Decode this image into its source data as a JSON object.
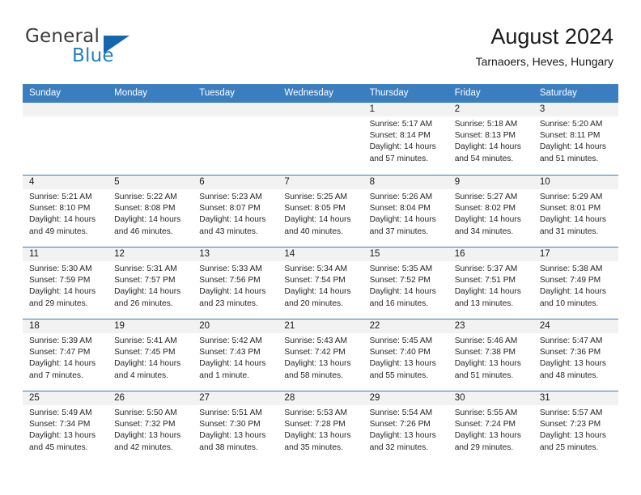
{
  "brand": {
    "name_part1": "General",
    "name_part2": "Blue",
    "accent_color": "#1666ad",
    "blue_text_color": "#1f7fc4"
  },
  "header": {
    "month_title": "August 2024",
    "location": "Tarnaoers, Heves, Hungary"
  },
  "calendar": {
    "header_background": "#3b7ec0",
    "weekday_headers": [
      "Sunday",
      "Monday",
      "Tuesday",
      "Wednesday",
      "Thursday",
      "Friday",
      "Saturday"
    ],
    "weeks": [
      [
        {
          "day": "",
          "sunrise": "",
          "sunset": "",
          "daylight1": "",
          "daylight2": ""
        },
        {
          "day": "",
          "sunrise": "",
          "sunset": "",
          "daylight1": "",
          "daylight2": ""
        },
        {
          "day": "",
          "sunrise": "",
          "sunset": "",
          "daylight1": "",
          "daylight2": ""
        },
        {
          "day": "",
          "sunrise": "",
          "sunset": "",
          "daylight1": "",
          "daylight2": ""
        },
        {
          "day": "1",
          "sunrise": "Sunrise: 5:17 AM",
          "sunset": "Sunset: 8:14 PM",
          "daylight1": "Daylight: 14 hours",
          "daylight2": "and 57 minutes."
        },
        {
          "day": "2",
          "sunrise": "Sunrise: 5:18 AM",
          "sunset": "Sunset: 8:13 PM",
          "daylight1": "Daylight: 14 hours",
          "daylight2": "and 54 minutes."
        },
        {
          "day": "3",
          "sunrise": "Sunrise: 5:20 AM",
          "sunset": "Sunset: 8:11 PM",
          "daylight1": "Daylight: 14 hours",
          "daylight2": "and 51 minutes."
        }
      ],
      [
        {
          "day": "4",
          "sunrise": "Sunrise: 5:21 AM",
          "sunset": "Sunset: 8:10 PM",
          "daylight1": "Daylight: 14 hours",
          "daylight2": "and 49 minutes."
        },
        {
          "day": "5",
          "sunrise": "Sunrise: 5:22 AM",
          "sunset": "Sunset: 8:08 PM",
          "daylight1": "Daylight: 14 hours",
          "daylight2": "and 46 minutes."
        },
        {
          "day": "6",
          "sunrise": "Sunrise: 5:23 AM",
          "sunset": "Sunset: 8:07 PM",
          "daylight1": "Daylight: 14 hours",
          "daylight2": "and 43 minutes."
        },
        {
          "day": "7",
          "sunrise": "Sunrise: 5:25 AM",
          "sunset": "Sunset: 8:05 PM",
          "daylight1": "Daylight: 14 hours",
          "daylight2": "and 40 minutes."
        },
        {
          "day": "8",
          "sunrise": "Sunrise: 5:26 AM",
          "sunset": "Sunset: 8:04 PM",
          "daylight1": "Daylight: 14 hours",
          "daylight2": "and 37 minutes."
        },
        {
          "day": "9",
          "sunrise": "Sunrise: 5:27 AM",
          "sunset": "Sunset: 8:02 PM",
          "daylight1": "Daylight: 14 hours",
          "daylight2": "and 34 minutes."
        },
        {
          "day": "10",
          "sunrise": "Sunrise: 5:29 AM",
          "sunset": "Sunset: 8:01 PM",
          "daylight1": "Daylight: 14 hours",
          "daylight2": "and 31 minutes."
        }
      ],
      [
        {
          "day": "11",
          "sunrise": "Sunrise: 5:30 AM",
          "sunset": "Sunset: 7:59 PM",
          "daylight1": "Daylight: 14 hours",
          "daylight2": "and 29 minutes."
        },
        {
          "day": "12",
          "sunrise": "Sunrise: 5:31 AM",
          "sunset": "Sunset: 7:57 PM",
          "daylight1": "Daylight: 14 hours",
          "daylight2": "and 26 minutes."
        },
        {
          "day": "13",
          "sunrise": "Sunrise: 5:33 AM",
          "sunset": "Sunset: 7:56 PM",
          "daylight1": "Daylight: 14 hours",
          "daylight2": "and 23 minutes."
        },
        {
          "day": "14",
          "sunrise": "Sunrise: 5:34 AM",
          "sunset": "Sunset: 7:54 PM",
          "daylight1": "Daylight: 14 hours",
          "daylight2": "and 20 minutes."
        },
        {
          "day": "15",
          "sunrise": "Sunrise: 5:35 AM",
          "sunset": "Sunset: 7:52 PM",
          "daylight1": "Daylight: 14 hours",
          "daylight2": "and 16 minutes."
        },
        {
          "day": "16",
          "sunrise": "Sunrise: 5:37 AM",
          "sunset": "Sunset: 7:51 PM",
          "daylight1": "Daylight: 14 hours",
          "daylight2": "and 13 minutes."
        },
        {
          "day": "17",
          "sunrise": "Sunrise: 5:38 AM",
          "sunset": "Sunset: 7:49 PM",
          "daylight1": "Daylight: 14 hours",
          "daylight2": "and 10 minutes."
        }
      ],
      [
        {
          "day": "18",
          "sunrise": "Sunrise: 5:39 AM",
          "sunset": "Sunset: 7:47 PM",
          "daylight1": "Daylight: 14 hours",
          "daylight2": "and 7 minutes."
        },
        {
          "day": "19",
          "sunrise": "Sunrise: 5:41 AM",
          "sunset": "Sunset: 7:45 PM",
          "daylight1": "Daylight: 14 hours",
          "daylight2": "and 4 minutes."
        },
        {
          "day": "20",
          "sunrise": "Sunrise: 5:42 AM",
          "sunset": "Sunset: 7:43 PM",
          "daylight1": "Daylight: 14 hours",
          "daylight2": "and 1 minute."
        },
        {
          "day": "21",
          "sunrise": "Sunrise: 5:43 AM",
          "sunset": "Sunset: 7:42 PM",
          "daylight1": "Daylight: 13 hours",
          "daylight2": "and 58 minutes."
        },
        {
          "day": "22",
          "sunrise": "Sunrise: 5:45 AM",
          "sunset": "Sunset: 7:40 PM",
          "daylight1": "Daylight: 13 hours",
          "daylight2": "and 55 minutes."
        },
        {
          "day": "23",
          "sunrise": "Sunrise: 5:46 AM",
          "sunset": "Sunset: 7:38 PM",
          "daylight1": "Daylight: 13 hours",
          "daylight2": "and 51 minutes."
        },
        {
          "day": "24",
          "sunrise": "Sunrise: 5:47 AM",
          "sunset": "Sunset: 7:36 PM",
          "daylight1": "Daylight: 13 hours",
          "daylight2": "and 48 minutes."
        }
      ],
      [
        {
          "day": "25",
          "sunrise": "Sunrise: 5:49 AM",
          "sunset": "Sunset: 7:34 PM",
          "daylight1": "Daylight: 13 hours",
          "daylight2": "and 45 minutes."
        },
        {
          "day": "26",
          "sunrise": "Sunrise: 5:50 AM",
          "sunset": "Sunset: 7:32 PM",
          "daylight1": "Daylight: 13 hours",
          "daylight2": "and 42 minutes."
        },
        {
          "day": "27",
          "sunrise": "Sunrise: 5:51 AM",
          "sunset": "Sunset: 7:30 PM",
          "daylight1": "Daylight: 13 hours",
          "daylight2": "and 38 minutes."
        },
        {
          "day": "28",
          "sunrise": "Sunrise: 5:53 AM",
          "sunset": "Sunset: 7:28 PM",
          "daylight1": "Daylight: 13 hours",
          "daylight2": "and 35 minutes."
        },
        {
          "day": "29",
          "sunrise": "Sunrise: 5:54 AM",
          "sunset": "Sunset: 7:26 PM",
          "daylight1": "Daylight: 13 hours",
          "daylight2": "and 32 minutes."
        },
        {
          "day": "30",
          "sunrise": "Sunrise: 5:55 AM",
          "sunset": "Sunset: 7:24 PM",
          "daylight1": "Daylight: 13 hours",
          "daylight2": "and 29 minutes."
        },
        {
          "day": "31",
          "sunrise": "Sunrise: 5:57 AM",
          "sunset": "Sunset: 7:23 PM",
          "daylight1": "Daylight: 13 hours",
          "daylight2": "and 25 minutes."
        }
      ]
    ]
  }
}
